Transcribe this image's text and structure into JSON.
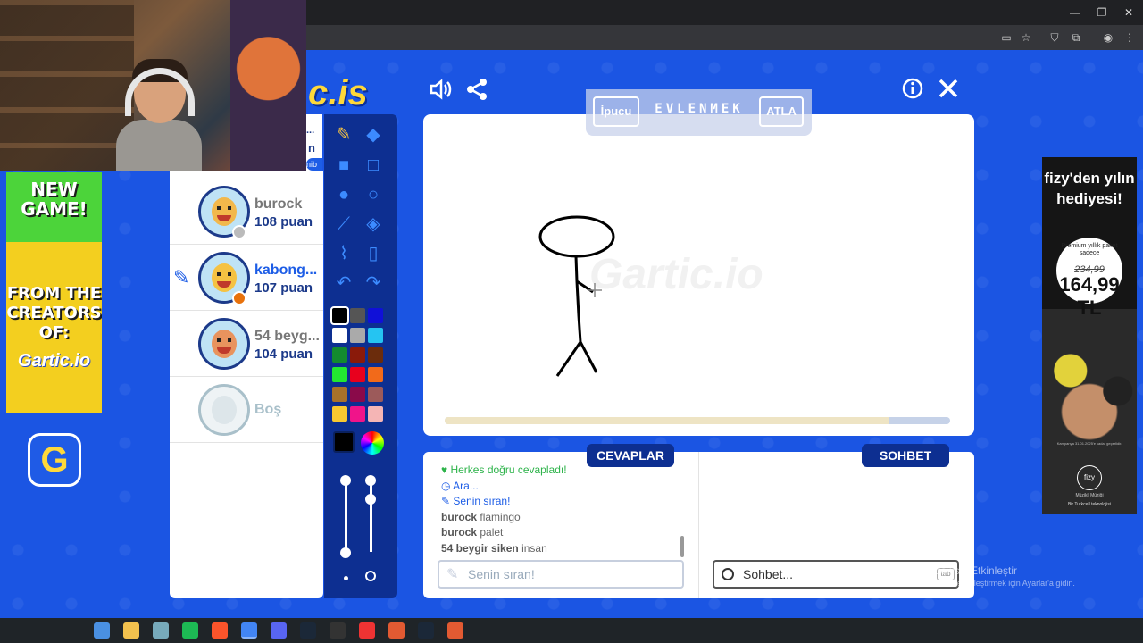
{
  "window": {
    "minimize": "—",
    "restore": "❐",
    "close": "✕"
  },
  "game": {
    "logo": "c.is",
    "watermark": "Gartic.io"
  },
  "left_ad": {
    "new_game": "NEW GAME!",
    "from_creators": "FROM THE CREATORS OF:",
    "logo": "Gartic.io",
    "icon": "G"
  },
  "players": [
    {
      "name": "burock",
      "points": "108 puan",
      "name_color": "#777777",
      "face_color": "#f2b84b",
      "status_color": "#bbbbbb",
      "drawing": false
    },
    {
      "name": "kabong...",
      "points": "107 puan",
      "name_color": "#1d5de6",
      "face_color": "#f5c242",
      "status_color": "#e8720c",
      "drawing": true
    },
    {
      "name": "54 beyg...",
      "points": "104 puan",
      "name_color": "#777777",
      "face_color": "#e8935e",
      "status_color": "",
      "drawing": false
    },
    {
      "name": "Boş",
      "points": "",
      "name_color": "#a9c0ca",
      "face_color": "#dde6ea",
      "status_color": "",
      "drawing": false
    }
  ],
  "header_partial": {
    "line1": "...",
    "line2": "n",
    "line3": "nib"
  },
  "word_bar": {
    "hint": "İpucu",
    "word": "EVLENMEK",
    "skip": "ATLA"
  },
  "canvas": {
    "progress": 0.88
  },
  "colors": [
    "#000000",
    "#555555",
    "#1010d8",
    "#ffffff",
    "#aaaaaa",
    "#25c4f2",
    "#138a2e",
    "#8a1a0a",
    "#6b2c0c",
    "#23e830",
    "#e8001d",
    "#f26a1a",
    "#a8722a",
    "#8a0a4a",
    "#9c5a5a",
    "#f8c830",
    "#f0148a",
    "#f5b5b5"
  ],
  "answers": {
    "tab": "CEVAPLAR",
    "messages": [
      {
        "icon": "♥",
        "user": "",
        "text": "Herkes doğru cevapladı!",
        "style": "green"
      },
      {
        "icon": "◷",
        "user": "",
        "text": "Ara...",
        "style": "blue"
      },
      {
        "icon": "✎",
        "user": "",
        "text": "Senin sıran!",
        "style": "blue"
      },
      {
        "icon": "",
        "user": "burock",
        "text": "flamingo",
        "style": ""
      },
      {
        "icon": "",
        "user": "burock",
        "text": "palet",
        "style": ""
      },
      {
        "icon": "",
        "user": "54 beygir siken",
        "text": "insan",
        "style": ""
      }
    ],
    "input_placeholder": "Senin sıran!"
  },
  "chat": {
    "tab": "SOHBET",
    "input_placeholder": "Sohbet...",
    "tab_key": "tab"
  },
  "windows_watermark": {
    "line1": "Windows'u Etkinleştir",
    "line2": "Windows'u etkinleştirmek için Ayarlar'a gidin."
  },
  "right_ad": {
    "headline": "fizy'den yılın hediyesi!",
    "promo": "Premium yıllık paket sadece",
    "old_price": "234,99",
    "new_price": "164,99 TL",
    "brand": "fizy",
    "brand_sub": "Müzikli Müziği",
    "fine_print": "Kampanya 31.01.2025'e kadar geçerlidir.",
    "footer": "Bir Turkcell teknolojisi"
  },
  "taskbar_icons": [
    "#4a90e2",
    "#f2c14e",
    "#7ab",
    "#1db954",
    "#fb542b",
    "#4285f4",
    "#5865f2",
    "#1b2838",
    "#333333",
    "#e33",
    "#e25a32",
    "#1b2838",
    "#e25a32"
  ]
}
